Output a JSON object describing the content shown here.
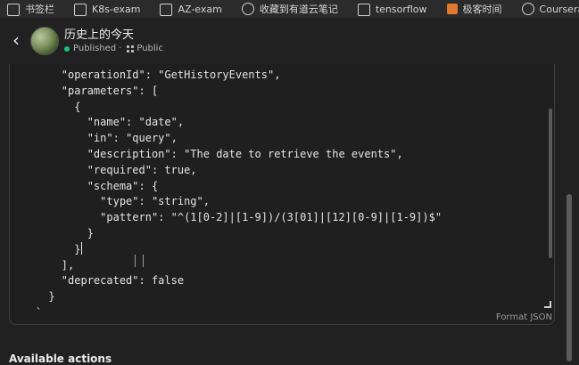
{
  "bookmarks": [
    {
      "label": "书签栏",
      "icon": "folder-icon"
    },
    {
      "label": "K8s-exam",
      "icon": "folder-icon"
    },
    {
      "label": "AZ-exam",
      "icon": "folder-icon"
    },
    {
      "label": "收藏到有道云笔记",
      "icon": "globe-icon"
    },
    {
      "label": "tensorflow",
      "icon": "folder-icon"
    },
    {
      "label": "极客时间",
      "icon": "app-icon"
    },
    {
      "label": "Coursera | Or",
      "icon": "globe-icon"
    }
  ],
  "header": {
    "title": "历史上的今天",
    "status": "Published",
    "separator": "·",
    "visibility": "Public"
  },
  "editor": {
    "lines": [
      "        \"operationId\": \"GetHistoryEvents\",",
      "        \"parameters\": [",
      "          {",
      "            \"name\": \"date\",",
      "            \"in\": \"query\",",
      "            \"description\": \"The date to retrieve the events\",",
      "            \"required\": true,",
      "            \"schema\": {",
      "              \"type\": \"string\",",
      "              \"pattern\": \"^(1[0-2]|[1-9])/(3[01]|[12][0-9]|[1-9])$\"",
      "            }",
      "          }",
      "        ],",
      "        \"deprecated\": false",
      "      }",
      "    `"
    ],
    "format_label": "Format JSON"
  },
  "section": {
    "available_actions": "Available actions"
  },
  "colors": {
    "background": "#212121",
    "published_dot": "#19c37d"
  }
}
